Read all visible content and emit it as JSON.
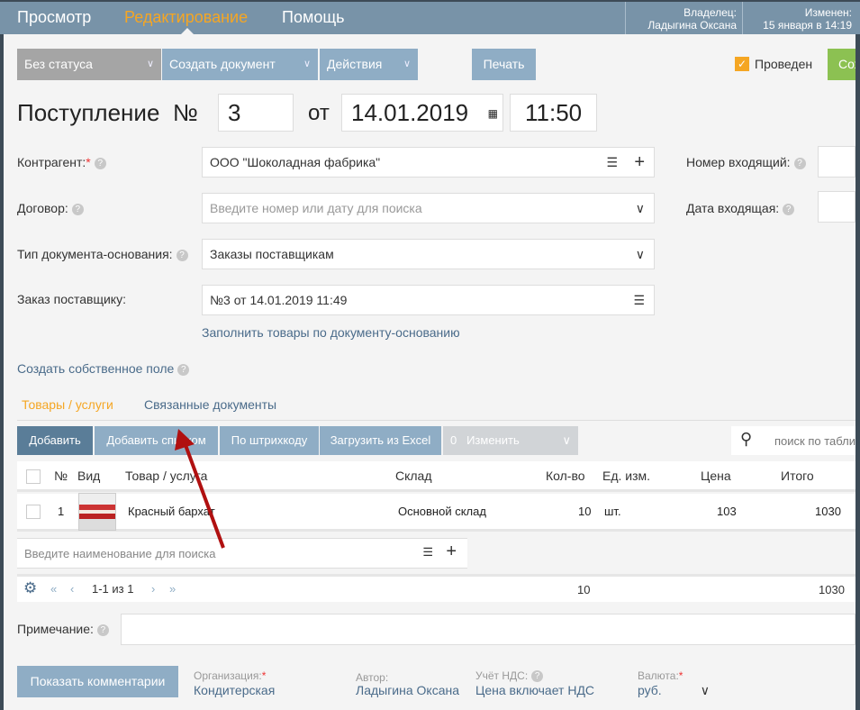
{
  "nav": {
    "items": [
      "Просмотр",
      "Редактирование",
      "Помощь"
    ],
    "active": "Редактирование"
  },
  "meta": {
    "owner_label": "Владелец:",
    "owner": "Ладыгина Оксана",
    "changed_label": "Изменен:",
    "changed": "15 января в 14:19"
  },
  "toolbar": {
    "status": "Без статуса",
    "create": "Создать документ",
    "actions": "Действия",
    "print": "Печать",
    "posted": "Проведен",
    "save": "Сох"
  },
  "doc": {
    "title": "Поступление",
    "num_label": "№",
    "number": "3",
    "from": "от",
    "date": "14.01.2019",
    "time": "11:50"
  },
  "form": {
    "counterparty_label": "Контрагент:",
    "counterparty": "ООО \"Шоколадная фабрика\"",
    "contract_label": "Договор:",
    "contract_placeholder": "Введите номер или дату для поиска",
    "basis_type_label": "Тип документа-основания:",
    "basis_type": "Заказы поставщикам",
    "order_label": "Заказ поставщику:",
    "order": "№3 от 14.01.2019 11:49",
    "fill_link": "Заполнить товары по документу-основанию",
    "incoming_num_label": "Номер входящий:",
    "incoming_date_label": "Дата входящая:",
    "custom_field": "Создать собственное поле"
  },
  "tabs": [
    "Товары / услуги",
    "Связанные документы"
  ],
  "table_toolbar": {
    "add": "Добавить",
    "add_list": "Добавить списком",
    "barcode": "По штрихкоду",
    "excel": "Загрузить из Excel",
    "count": "0",
    "change": "Изменить",
    "search_placeholder": "поиск по табли"
  },
  "table": {
    "headers": [
      "№",
      "Вид",
      "Товар / услуга",
      "Склад",
      "Кол-во",
      "Ед. изм.",
      "Цена",
      "Итого"
    ],
    "rows": [
      {
        "n": "1",
        "name": "Красный бархат",
        "warehouse": "Основной склад",
        "qty": "10",
        "unit": "шт.",
        "price": "103",
        "total": "1030"
      }
    ],
    "new_placeholder": "Введите наименование для поиска",
    "pager": "1-1 из 1",
    "total_qty": "10",
    "total_sum": "1030"
  },
  "note_label": "Примечание:",
  "footer": {
    "comments": "Показать комментарии",
    "org_label": "Организация:",
    "org": "Кондитерская",
    "author_label": "Автор:",
    "author": "Ладыгина Оксана",
    "vat_label": "Учёт НДС:",
    "vat": "Цена включает НДС",
    "currency_label": "Валюта:",
    "currency": "руб."
  },
  "colors": {
    "topbar": "#7893a8",
    "accent": "#f5a623",
    "button": "#8fadc5",
    "annotation_arrow": "#b01010"
  }
}
